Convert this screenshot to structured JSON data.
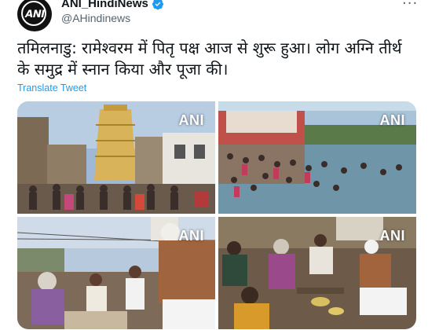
{
  "tweet": {
    "display_name": "ANI_HindiNews",
    "handle": "@AHindinews",
    "avatar_text": "ANI",
    "text": "तमिलनाडु: रामेश्वरम में पितृ पक्ष आज से शुरू हुआ। लोग अग्नि तीर्थ के समुद्र में स्नान किया और पूजा की।",
    "translate_label": "Translate Tweet",
    "more_label": "···"
  },
  "media": {
    "watermark": "ANI",
    "photos": [
      {
        "scene": "temple-gopuram-street"
      },
      {
        "scene": "agni-theertham-sea-bathing"
      },
      {
        "scene": "priest-ritual-street"
      },
      {
        "scene": "pooja-gathering"
      }
    ]
  },
  "colors": {
    "accent": "#1d9bf0",
    "text": "#0f1419",
    "secondary": "#536471"
  }
}
